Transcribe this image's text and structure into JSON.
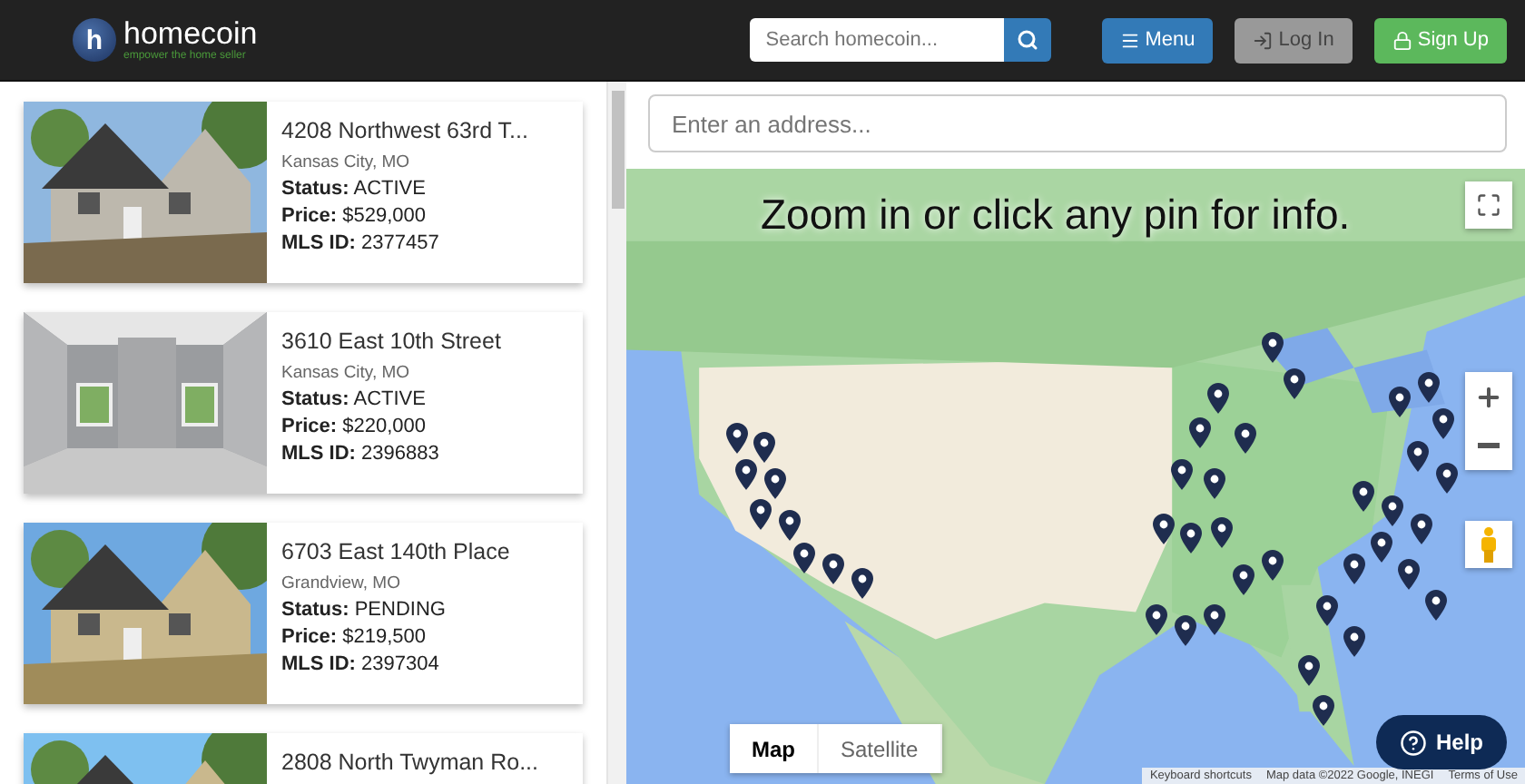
{
  "header": {
    "brand": "homecoin",
    "tagline": "empower the home seller",
    "logo_letter": "h",
    "search": {
      "placeholder": "Search homecoin..."
    },
    "buttons": [
      {
        "kind": "menu",
        "label": "Menu"
      },
      {
        "kind": "login",
        "label": "Log In"
      },
      {
        "kind": "signup",
        "label": "Sign Up"
      }
    ]
  },
  "listings": [
    {
      "address": "4208 Northwest 63rd T...",
      "city": "Kansas City, MO",
      "status_label": "Status:",
      "status": "ACTIVE",
      "price_label": "Price:",
      "price": "$529,000",
      "mls_label": "MLS ID:",
      "mls": "2377457"
    },
    {
      "address": "3610 East 10th Street",
      "city": "Kansas City, MO",
      "status_label": "Status:",
      "status": "ACTIVE",
      "price_label": "Price:",
      "price": "$220,000",
      "mls_label": "MLS ID:",
      "mls": "2396883"
    },
    {
      "address": "6703 East 140th Place",
      "city": "Grandview, MO",
      "status_label": "Status:",
      "status": "PENDING",
      "price_label": "Price:",
      "price": "$219,500",
      "mls_label": "MLS ID:",
      "mls": "2397304"
    },
    {
      "address": "2808 North Twyman Ro..."
    }
  ],
  "address_field": {
    "placeholder": "Enter an address..."
  },
  "map": {
    "hint": "Zoom in or click any pin for info.",
    "map_types": [
      {
        "label": "Map",
        "selected": true
      },
      {
        "label": "Satellite",
        "selected": false
      }
    ],
    "attribution": [
      "Keyboard shortcuts",
      "Map data ©2022 Google, INEGI",
      "Terms of Use"
    ],
    "help": "Help"
  }
}
